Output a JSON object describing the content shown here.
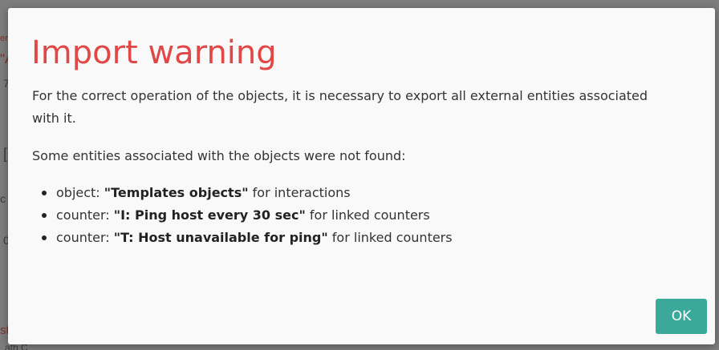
{
  "background": {
    "fragments": [
      "em",
      "\"A",
      "7",
      "[",
      "c",
      "0",
      "st",
      "ath  C"
    ]
  },
  "dialog": {
    "title": "Import warning",
    "intro": "For the correct operation of the objects, it is necessary to export all external entities associated with it.",
    "not_found_heading": "Some entities associated with the objects were not found:",
    "entities": [
      {
        "type": "object:",
        "name": "\"Templates objects\"",
        "purpose": "for interactions"
      },
      {
        "type": "counter:",
        "name": "\"I: Ping host every 30 sec\"",
        "purpose": "for linked counters"
      },
      {
        "type": "counter:",
        "name": "\"T: Host unavailable for ping\"",
        "purpose": "for linked counters"
      }
    ],
    "ok_label": "OK"
  },
  "colors": {
    "title": "#e04848",
    "ok_button": "#3aa89a",
    "modal_bg": "#f9f9f9",
    "overlay": "#7d7d7d"
  }
}
